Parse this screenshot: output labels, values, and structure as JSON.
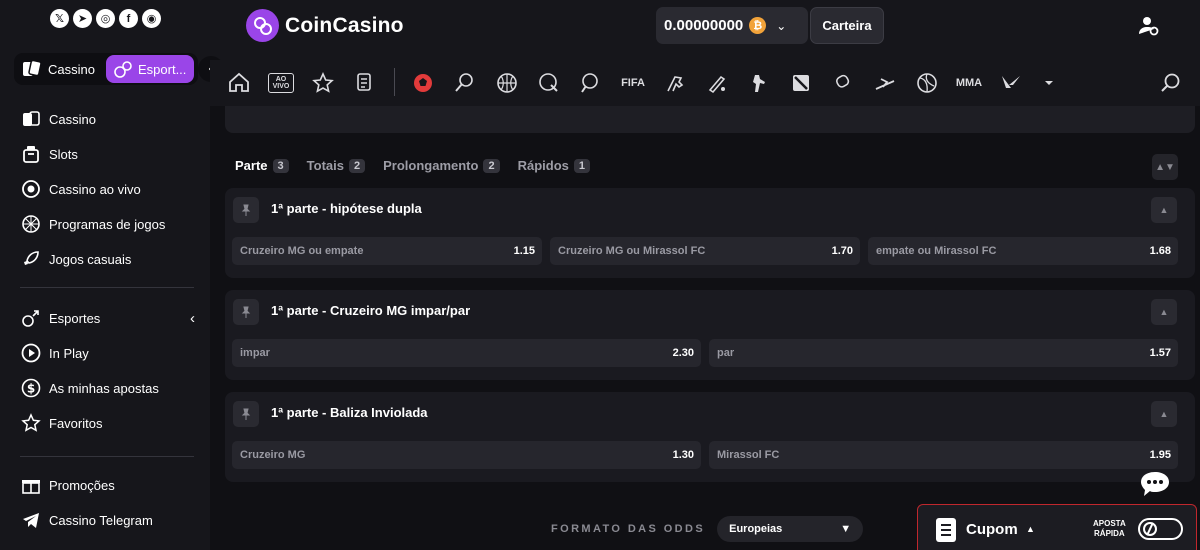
{
  "brand": {
    "name": "CoinCasino"
  },
  "socials": [
    {
      "icon": "x-icon",
      "glyph": "𝕏"
    },
    {
      "icon": "telegram-icon",
      "glyph": "➤"
    },
    {
      "icon": "instagram-icon",
      "glyph": "◎"
    },
    {
      "icon": "facebook-icon",
      "glyph": "f"
    },
    {
      "icon": "discord-icon",
      "glyph": "◉"
    }
  ],
  "mode_switch": {
    "casino_label": "Cassino",
    "sports_label": "Esport..."
  },
  "sidebar": {
    "casino_items": [
      {
        "label": "Cassino",
        "icon": "cards-icon"
      },
      {
        "label": "Slots",
        "icon": "slot-machine-icon"
      },
      {
        "label": "Cassino ao vivo",
        "icon": "live-casino-icon"
      },
      {
        "label": "Programas de jogos",
        "icon": "game-show-icon"
      },
      {
        "label": "Jogos casuais",
        "icon": "rocket-icon"
      }
    ],
    "sports_items": [
      {
        "label": "Esportes",
        "icon": "sports-icon"
      },
      {
        "label": "In Play",
        "icon": "play-icon"
      },
      {
        "label": "As minhas apostas",
        "icon": "dollar-icon"
      },
      {
        "label": "Favoritos",
        "icon": "star-icon"
      }
    ],
    "extra_items": [
      {
        "label": "Promoções",
        "icon": "gift-icon"
      },
      {
        "label": "Cassino Telegram",
        "icon": "telegram-icon"
      }
    ]
  },
  "header": {
    "balance": "0.00000000",
    "currency_glyph": "₿",
    "wallet_label": "Carteira"
  },
  "sportbar": {
    "items": [
      {
        "icon": "home-icon"
      },
      {
        "icon": "live-icon",
        "text": "AO VIVO"
      },
      {
        "icon": "star-icon"
      },
      {
        "icon": "betslip-icon"
      },
      {
        "icon": "soccer-icon"
      },
      {
        "icon": "tennis-icon"
      },
      {
        "icon": "basketball-icon"
      },
      {
        "icon": "hockey-icon"
      },
      {
        "icon": "table-tennis-icon"
      },
      {
        "icon": "fifa-icon",
        "text": "FIFA"
      },
      {
        "icon": "horse-racing-icon"
      },
      {
        "icon": "cricket-icon"
      },
      {
        "icon": "counter-strike-icon"
      },
      {
        "icon": "dota-icon"
      },
      {
        "icon": "boxing-icon"
      },
      {
        "icon": "skiing-icon"
      },
      {
        "icon": "volleyball-icon"
      },
      {
        "icon": "mma-icon",
        "text": "MMA"
      },
      {
        "icon": "valorant-icon"
      },
      {
        "icon": "more-dropdown-icon"
      }
    ]
  },
  "tabs": [
    {
      "label": "Parte",
      "count": "3",
      "active": true
    },
    {
      "label": "Totais",
      "count": "2",
      "active": false
    },
    {
      "label": "Prolongamento",
      "count": "2",
      "active": false
    },
    {
      "label": "Rápidos",
      "count": "1",
      "active": false
    }
  ],
  "markets": [
    {
      "title": "1ª parte - hipótese dupla",
      "odds": [
        {
          "label": "Cruzeiro MG ou empate",
          "value": "1.15"
        },
        {
          "label": "Cruzeiro MG ou Mirassol FC",
          "value": "1.70"
        },
        {
          "label": "empate ou Mirassol FC",
          "value": "1.68"
        }
      ]
    },
    {
      "title": "1ª parte - Cruzeiro MG impar/par",
      "odds": [
        {
          "label": "impar",
          "value": "2.30"
        },
        {
          "label": "par",
          "value": "1.57"
        }
      ]
    },
    {
      "title": "1ª parte - Baliza Inviolada",
      "odds": [
        {
          "label": "Cruzeiro MG",
          "value": "1.30"
        },
        {
          "label": "Mirassol FC",
          "value": "1.95"
        }
      ]
    }
  ],
  "odds_format": {
    "label": "FORMATO DAS ODDS",
    "selected": "Europeias"
  },
  "coupon": {
    "label": "Cupom",
    "quick_bet_line1": "APOSTA",
    "quick_bet_line2": "RÁPIDA"
  },
  "colors": {
    "accent": "#9a45e8",
    "bitcoin": "#f2a33a",
    "coupon_border": "#c0272d"
  }
}
